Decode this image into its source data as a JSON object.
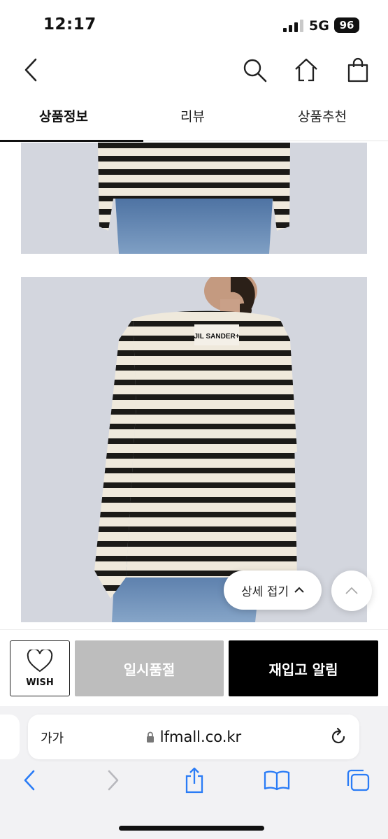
{
  "status_bar": {
    "time": "12:17",
    "network": "5G",
    "battery": "96"
  },
  "header": {
    "icons": [
      "back-icon",
      "search-icon",
      "home-icon",
      "shopping-bag-icon"
    ]
  },
  "tabs": [
    {
      "label": "상품정보",
      "active": true
    },
    {
      "label": "리뷰",
      "active": false
    },
    {
      "label": "상품추천",
      "active": false
    }
  ],
  "product": {
    "brand_print": "JIL SANDER+"
  },
  "floating": {
    "collapse_label": "상세 접기"
  },
  "actions": {
    "wish_label": "WISH",
    "soldout_label": "일시품절",
    "restock_label": "재입고 알림"
  },
  "browser": {
    "text_size_label": "가가",
    "url": "lfmall.co.kr"
  },
  "colors": {
    "accent": "#000000",
    "disabled": "#bdbdbd",
    "tab_underline": "#111111"
  }
}
